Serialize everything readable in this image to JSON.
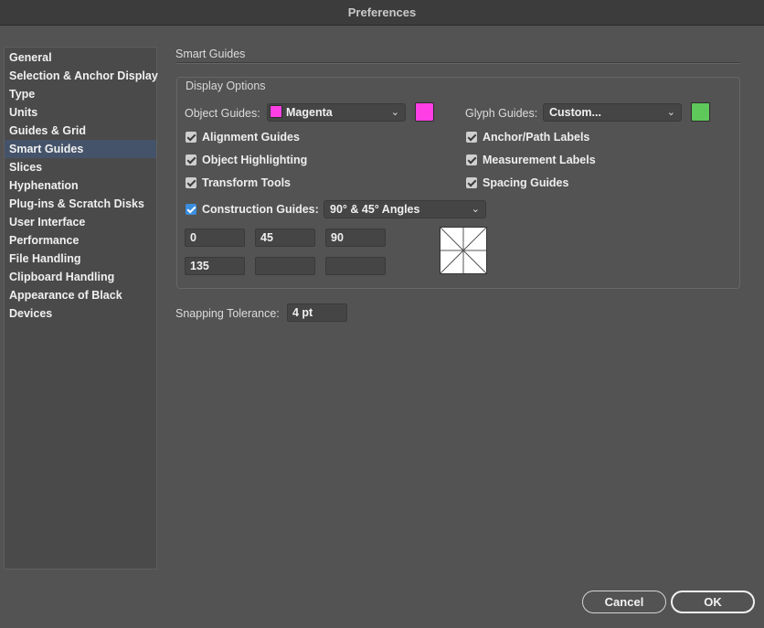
{
  "window": {
    "title": "Preferences"
  },
  "sidebar": {
    "items": [
      {
        "label": "General"
      },
      {
        "label": "Selection & Anchor Display"
      },
      {
        "label": "Type"
      },
      {
        "label": "Units"
      },
      {
        "label": "Guides & Grid"
      },
      {
        "label": "Smart Guides"
      },
      {
        "label": "Slices"
      },
      {
        "label": "Hyphenation"
      },
      {
        "label": "Plug-ins & Scratch Disks"
      },
      {
        "label": "User Interface"
      },
      {
        "label": "Performance"
      },
      {
        "label": "File Handling"
      },
      {
        "label": "Clipboard Handling"
      },
      {
        "label": "Appearance of Black"
      },
      {
        "label": "Devices"
      }
    ],
    "selected": "Smart Guides"
  },
  "panel": {
    "title": "Smart Guides",
    "display_options": {
      "label": "Display Options",
      "object_guides": {
        "label": "Object Guides:",
        "value": "Magenta",
        "color": "#ff3fe5"
      },
      "glyph_guides": {
        "label": "Glyph Guides:",
        "value": "Custom...",
        "color": "#5fc85a"
      },
      "checkboxes": {
        "alignment_guides": {
          "label": "Alignment Guides",
          "checked": true
        },
        "object_highlighting": {
          "label": "Object Highlighting",
          "checked": true
        },
        "transform_tools": {
          "label": "Transform Tools",
          "checked": true
        },
        "anchor_path_labels": {
          "label": "Anchor/Path Labels",
          "checked": true
        },
        "measurement_labels": {
          "label": "Measurement Labels",
          "checked": true
        },
        "spacing_guides": {
          "label": "Spacing Guides",
          "checked": true
        },
        "construction_guides": {
          "label": "Construction Guides:",
          "checked": true
        }
      },
      "construction_angles": {
        "value": "90° & 45° Angles"
      },
      "angle_fields": [
        "0",
        "45",
        "90",
        "135",
        "",
        ""
      ]
    },
    "snapping_tolerance": {
      "label": "Snapping Tolerance:",
      "value": "4 pt"
    }
  },
  "buttons": {
    "cancel": "Cancel",
    "ok": "OK"
  },
  "icons": {
    "dropdown": "chevron-down-icon",
    "check": "checkmark-icon"
  },
  "colors": {
    "background": "#535353",
    "selection": "#45536a",
    "checkbox_accent": "#3b8ede"
  }
}
